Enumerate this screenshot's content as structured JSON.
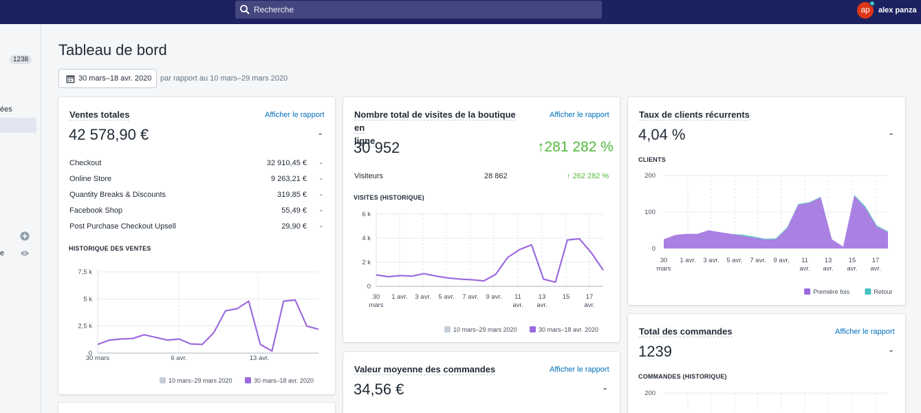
{
  "search": {
    "placeholder": "Recherche"
  },
  "user": {
    "initials": "ap",
    "name": "alex panza"
  },
  "sidebar": {
    "badge": "1238",
    "partial_1": "ées",
    "partial_2": "e"
  },
  "page": {
    "title": "Tableau de bord",
    "date_range": "30 mars–18 avr. 2020",
    "compare_text": "par rapport au 10 mars–29 mars 2020"
  },
  "sales": {
    "title": "Ventes totales",
    "link": "Afficher le rapport",
    "value": "42 578,90 €",
    "change": "-",
    "rows": [
      {
        "label": "Checkout",
        "value": "32 910,45 €",
        "change": "-"
      },
      {
        "label": "Online Store",
        "value": "9 263,21 €",
        "change": "-"
      },
      {
        "label": "Quantity Breaks & Discounts",
        "value": "319,85 €",
        "change": "-"
      },
      {
        "label": "Facebook Shop",
        "value": "55,49 €",
        "change": "-"
      },
      {
        "label": "Post Purchase Checkout Upsell",
        "value": "29,90 €",
        "change": "-"
      }
    ],
    "chart_title": "HISTORIQUE DES VENTES"
  },
  "visits": {
    "title_line1": "Nombre total de visites de la boutique en",
    "title_line2": "ligne",
    "link": "Afficher le rapport",
    "value": "30 952",
    "change": "281 282 %",
    "visitors_label": "Visiteurs",
    "visitors_value": "28 862",
    "visitors_change": "262 282 %",
    "chart_title": "VISITES (HISTORIQUE)"
  },
  "aov": {
    "title": "Valeur moyenne des commandes",
    "link": "Afficher le rapport",
    "value": "34,56 €",
    "change": "-"
  },
  "returning": {
    "title": "Taux de clients récurrents",
    "value": "4,04 %",
    "change": "-",
    "chart_title": "CLIENTS"
  },
  "orders": {
    "title": "Total des commandes",
    "link": "Afficher le rapport",
    "value": "1239",
    "change": "-",
    "chart_title": "COMMANDES (HISTORIQUE)"
  },
  "colors": {
    "accent": "#9c6ade",
    "prev_period": "#c4cdd5",
    "return": "#47c1bf",
    "topbar": "#1c2260",
    "link": "#006fbb",
    "positive": "#50b83c"
  },
  "chart_data": [
    {
      "type": "line",
      "title": "HISTORIQUE DES VENTES",
      "ylim": [
        0,
        7500
      ],
      "yticks": [
        "0",
        "2,5 k",
        "5 k",
        "7,5 k"
      ],
      "xticks": [
        "30 mars",
        "6 avr.",
        "13 avr."
      ],
      "series": [
        {
          "name": "10 mars–29 mars 2020",
          "values": [
            0,
            0,
            0,
            0,
            0,
            0,
            0,
            0,
            0,
            0,
            0,
            0,
            0,
            0,
            0,
            0,
            0,
            0,
            0,
            0
          ]
        },
        {
          "name": "30 mars–18 avr. 2020",
          "values": [
            800,
            1200,
            1300,
            1350,
            1700,
            1450,
            1200,
            1300,
            850,
            800,
            1900,
            3900,
            4100,
            4800,
            800,
            200,
            4800,
            4900,
            2500,
            2200
          ]
        }
      ]
    },
    {
      "type": "line",
      "title": "VISITES (HISTORIQUE)",
      "ylim": [
        0,
        6000
      ],
      "yticks": [
        "0",
        "2 k",
        "4 k",
        "6 k"
      ],
      "xticks": [
        "30 mars",
        "1 avr.",
        "3 avr.",
        "5 avr.",
        "7 avr.",
        "9 avr.",
        "11 avr.",
        "13 avr.",
        "15",
        "17 avr."
      ],
      "series": [
        {
          "name": "10 mars–29 mars 2020",
          "values": [
            0,
            0,
            0,
            0,
            0,
            0,
            0,
            0,
            0,
            0,
            0,
            0,
            0,
            0,
            0,
            0,
            0,
            0,
            0,
            0
          ]
        },
        {
          "name": "30 mars–18 avr. 2020",
          "values": [
            950,
            800,
            900,
            850,
            1050,
            850,
            700,
            600,
            550,
            450,
            1000,
            2400,
            3050,
            3450,
            600,
            350,
            3850,
            3950,
            2800,
            1350
          ]
        }
      ]
    },
    {
      "type": "area",
      "title": "CLIENTS",
      "ylim": [
        0,
        200
      ],
      "yticks": [
        "0",
        "100",
        "200"
      ],
      "xticks": [
        "30 mars",
        "1 avr.",
        "3 avr.",
        "5 avr.",
        "7 avr.",
        "9 avr.",
        "11 avr.",
        "13 avr.",
        "15 avr.",
        "17 avr."
      ],
      "series": [
        {
          "name": "Première fois",
          "values": [
            25,
            37,
            40,
            40,
            50,
            45,
            40,
            35,
            30,
            25,
            25,
            55,
            120,
            125,
            140,
            25,
            5,
            145,
            110,
            60,
            45
          ]
        },
        {
          "name": "Retour",
          "values": [
            0,
            0,
            0,
            0,
            0,
            0,
            0,
            3,
            3,
            2,
            3,
            3,
            2,
            2,
            2,
            0,
            0,
            2,
            5,
            3,
            2
          ]
        }
      ]
    },
    {
      "type": "line",
      "title": "COMMANDES (HISTORIQUE)",
      "yticks": [
        "200"
      ],
      "series": []
    }
  ]
}
